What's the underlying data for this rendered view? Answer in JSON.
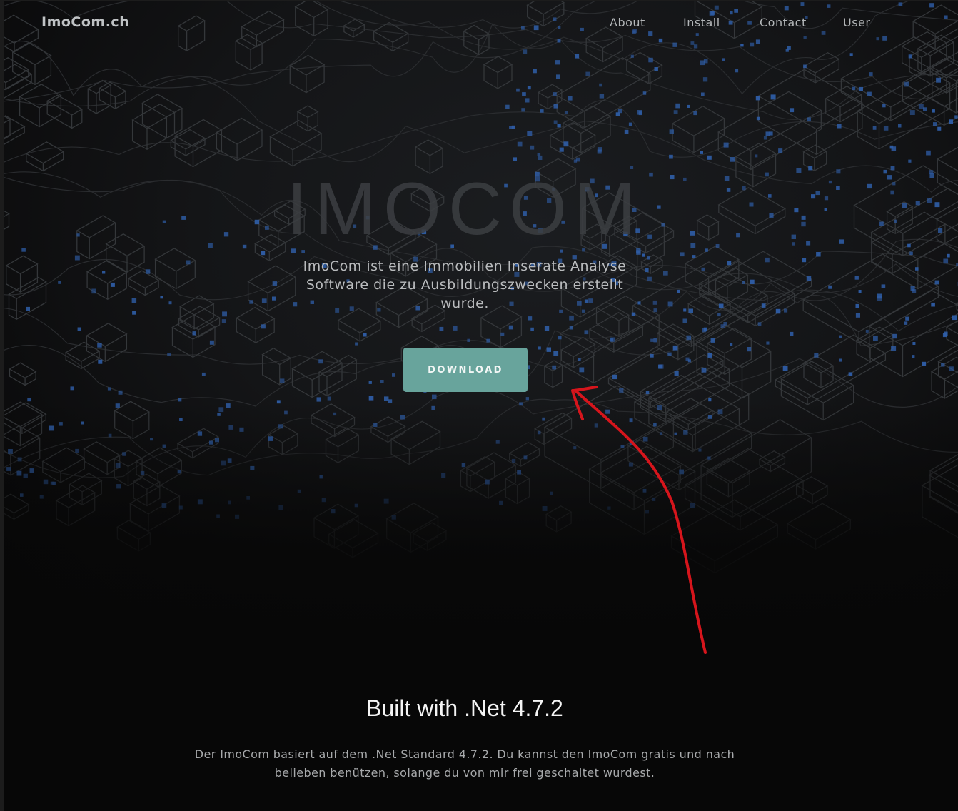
{
  "brand": "ImoCom.ch",
  "nav": {
    "about": "About",
    "install": "Install",
    "contact": "Contact",
    "user": "User"
  },
  "hero": {
    "title": "IMOCOM",
    "subtitle": "ImoCom ist eine Immobilien Inserate Analyse Software die zu Ausbildungszwecken erstellt wurde.",
    "download_label": "DOWNLOAD"
  },
  "section": {
    "title": "Built with .Net 4.7.2",
    "text": "Der ImoCom basiert auf dem .Net Standard 4.7.2. Du kannst den ImoCom gratis und nach belieben benützen, solange du von mir frei geschaltet wurdest."
  },
  "colors": {
    "accent": "#68a49c",
    "annotation_arrow": "#d6151c",
    "map_dots": "#2f5ea8",
    "background": "#070707"
  }
}
